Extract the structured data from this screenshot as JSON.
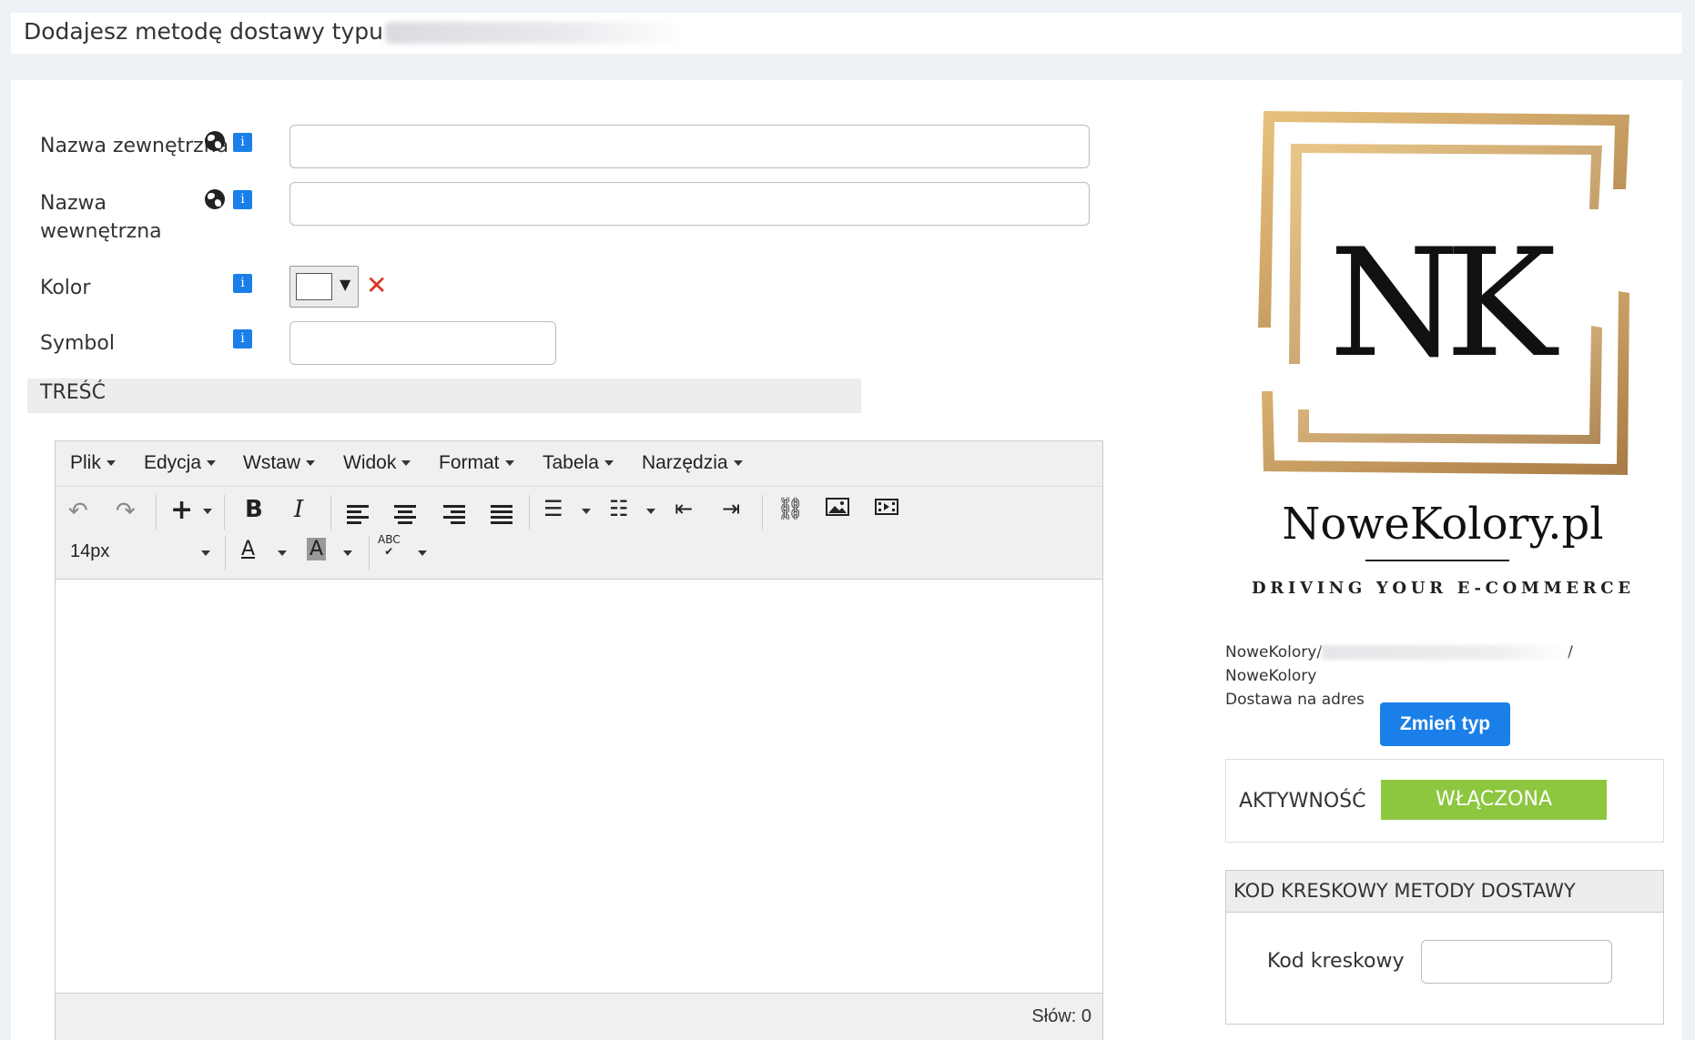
{
  "header": {
    "title": "Dodajesz metodę dostawy typu"
  },
  "form": {
    "external_name_label": "Nazwa zewnętrzna",
    "internal_name_label": "Nazwa wewnętrzna",
    "color_label": "Kolor",
    "symbol_label": "Symbol",
    "info_glyph": "i",
    "clear_glyph": "✕",
    "color_dropdown_glyph": "▼",
    "external_name_value": "",
    "internal_name_value": "",
    "symbol_value": ""
  },
  "content_section": {
    "title": "TREŚĆ"
  },
  "editor": {
    "menus": [
      "Plik",
      "Edycja",
      "Wstaw",
      "Widok",
      "Format",
      "Tabela",
      "Narzędzia"
    ],
    "font_size": "14px",
    "word_count": "Słów: 0"
  },
  "sidebar": {
    "logo": {
      "monogram": "NK",
      "brand": "NoweKolory.pl",
      "tagline": "DRIVING YOUR E-COMMERCE"
    },
    "path_start": "NoweKolory/",
    "path_end": "/ NoweKolory",
    "delivery_type": "Dostawa na adres",
    "change_type_button": "Zmień typ",
    "activity_label": "AKTYWNOŚĆ",
    "activity_status": "WŁĄCZONA",
    "barcode_section_title": "KOD KRESKOWY METODY DOSTAWY",
    "barcode_label": "Kod kreskowy",
    "barcode_value": ""
  },
  "colors": {
    "accent": "#1a7fe8",
    "active": "#8dc63f",
    "logo_gold": "#c9a064",
    "clear": "#dd3322"
  }
}
